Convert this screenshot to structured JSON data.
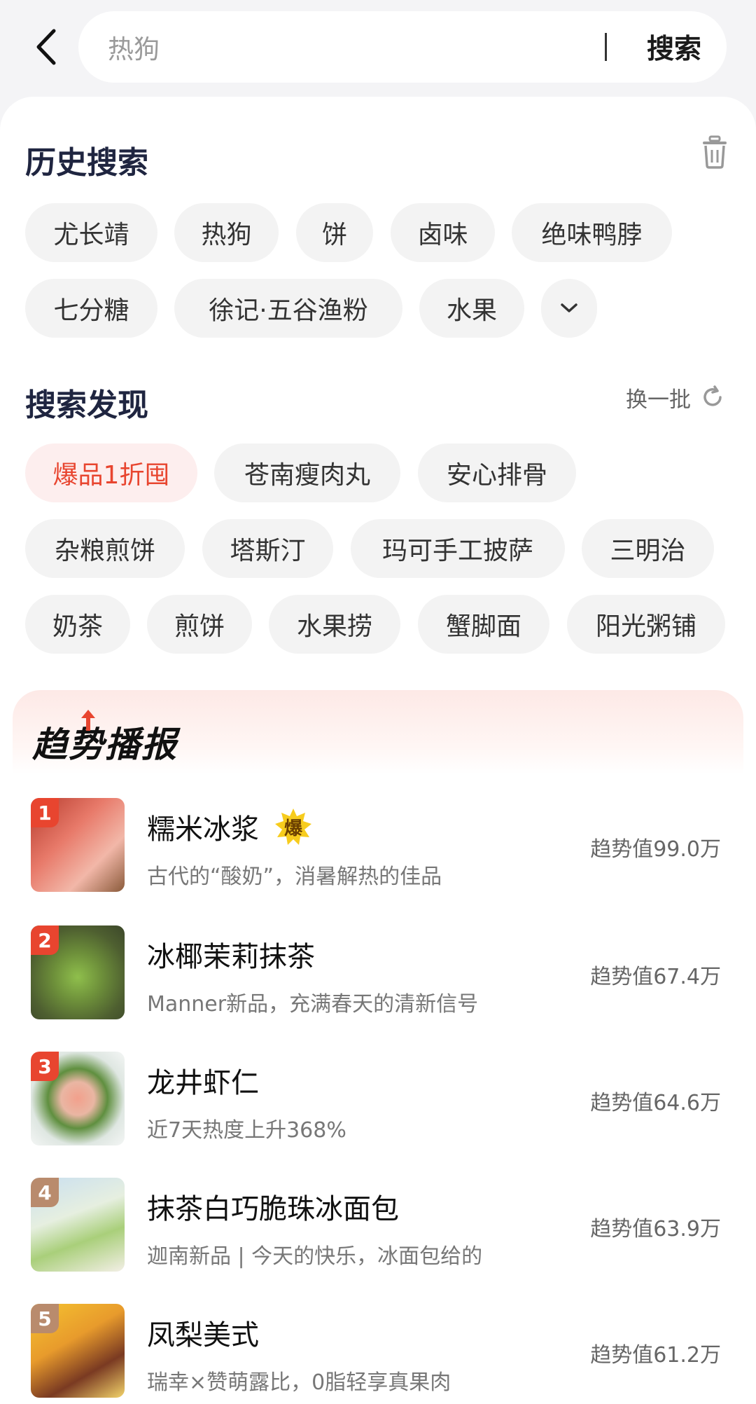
{
  "search": {
    "placeholder": "热狗",
    "button": "搜索"
  },
  "history": {
    "title": "历史搜索",
    "row1": [
      "尤长靖",
      "热狗",
      "饼",
      "卤味",
      "绝味鸭脖"
    ],
    "row2": [
      "七分糖",
      "徐记·五谷渔粉",
      "水果"
    ]
  },
  "discover": {
    "title": "搜索发现",
    "refresh_label": "换一批",
    "row1": [
      "爆品1折囤",
      "苍南瘦肉丸",
      "安心排骨"
    ],
    "row2": [
      "杂粮煎饼",
      "塔斯汀",
      "玛可手工披萨",
      "三明治"
    ],
    "row3": [
      "奶茶",
      "煎饼",
      "水果捞",
      "蟹脚面",
      "阳光粥铺"
    ]
  },
  "trend": {
    "title": "趋势播报",
    "badge": "爆",
    "items": [
      {
        "rank": "1",
        "name": "糯米冰浆",
        "desc": "古代的“酸奶”，消暑解热的佳品",
        "value": "趋势值99.0万"
      },
      {
        "rank": "2",
        "name": "冰椰茉莉抹茶",
        "desc": "Manner新品，充满春天的清新信号",
        "value": "趋势值67.4万"
      },
      {
        "rank": "3",
        "name": "龙井虾仁",
        "desc": "近7天热度上升368%",
        "value": "趋势值64.6万"
      },
      {
        "rank": "4",
        "name": "抹茶白巧脆珠冰面包",
        "desc": "迦南新品 | 今天的快乐，冰面包给的",
        "value": "趋势值63.9万"
      },
      {
        "rank": "5",
        "name": "凤梨美式",
        "desc": "瑞幸×赞萌露比，0脂轻享真果肉",
        "value": "趋势值61.2万"
      }
    ]
  },
  "colors": {
    "accent_red": "#e8452f",
    "hot_chip_bg": "#fdeeee",
    "chip_bg": "#f3f3f3",
    "rank_top": "#e8452f",
    "rank_other": "#b98b6d",
    "badge_yellow": "#f7cc1d"
  }
}
